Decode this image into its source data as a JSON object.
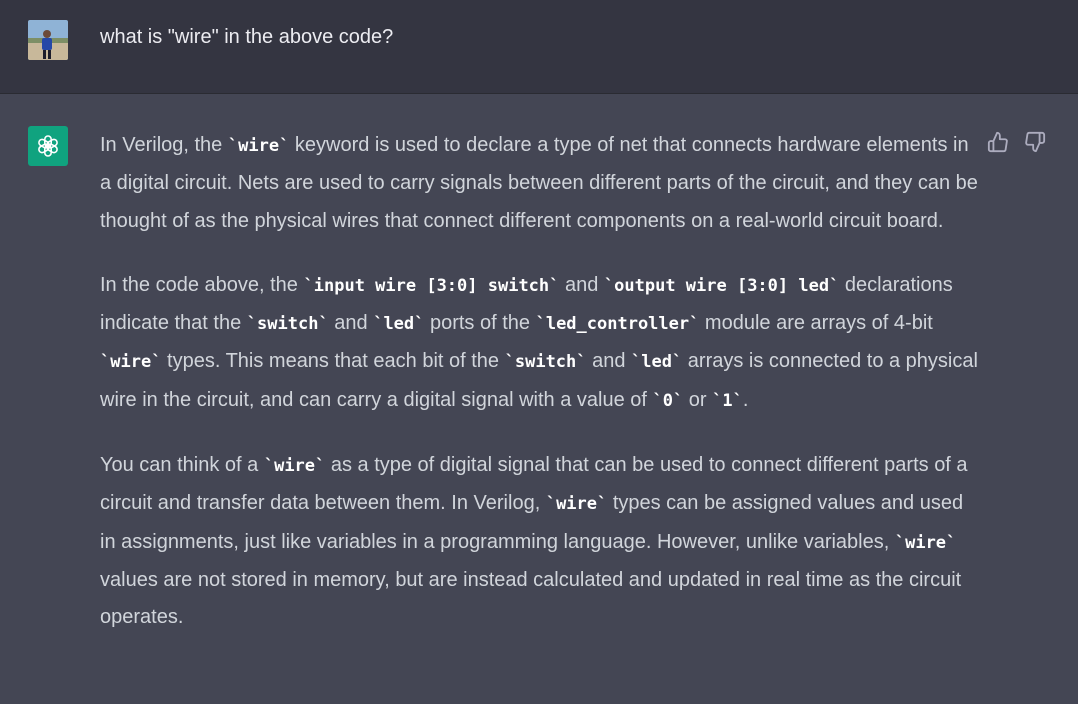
{
  "user_message": {
    "text": "what is \"wire\" in the above code?"
  },
  "assistant_message": {
    "paragraphs": [
      {
        "segments": [
          {
            "t": "text",
            "v": "In Verilog, the "
          },
          {
            "t": "code",
            "v": "wire"
          },
          {
            "t": "text",
            "v": " keyword is used to declare a type of net that connects hardware elements in a digital circuit. Nets are used to carry signals between different parts of the circuit, and they can be thought of as the physical wires that connect different components on a real-world circuit board."
          }
        ]
      },
      {
        "segments": [
          {
            "t": "text",
            "v": "In the code above, the "
          },
          {
            "t": "code",
            "v": "input wire [3:0] switch"
          },
          {
            "t": "text",
            "v": " and "
          },
          {
            "t": "code",
            "v": "output wire [3:0] led"
          },
          {
            "t": "text",
            "v": " declarations indicate that the "
          },
          {
            "t": "code",
            "v": "switch"
          },
          {
            "t": "text",
            "v": " and "
          },
          {
            "t": "code",
            "v": "led"
          },
          {
            "t": "text",
            "v": " ports of the "
          },
          {
            "t": "code",
            "v": "led_controller"
          },
          {
            "t": "text",
            "v": " module are arrays of 4-bit "
          },
          {
            "t": "code",
            "v": "wire"
          },
          {
            "t": "text",
            "v": " types. This means that each bit of the "
          },
          {
            "t": "code",
            "v": "switch"
          },
          {
            "t": "text",
            "v": " and "
          },
          {
            "t": "code",
            "v": "led"
          },
          {
            "t": "text",
            "v": " arrays is connected to a physical wire in the circuit, and can carry a digital signal with a value of "
          },
          {
            "t": "code",
            "v": "0"
          },
          {
            "t": "text",
            "v": " or "
          },
          {
            "t": "code",
            "v": "1"
          },
          {
            "t": "text",
            "v": "."
          }
        ]
      },
      {
        "segments": [
          {
            "t": "text",
            "v": "You can think of a "
          },
          {
            "t": "code",
            "v": "wire"
          },
          {
            "t": "text",
            "v": " as a type of digital signal that can be used to connect different parts of a circuit and transfer data between them. In Verilog, "
          },
          {
            "t": "code",
            "v": "wire"
          },
          {
            "t": "text",
            "v": " types can be assigned values and used in assignments, just like variables in a programming language. However, unlike variables, "
          },
          {
            "t": "code",
            "v": "wire"
          },
          {
            "t": "text",
            "v": " values are not stored in memory, but are instead calculated and updated in real time as the circuit operates."
          }
        ]
      }
    ]
  },
  "icons": {
    "user_avatar": "user-avatar-photo",
    "assistant_avatar": "openai-logo-icon",
    "thumbs_up": "thumbs-up-icon",
    "thumbs_down": "thumbs-down-icon"
  },
  "colors": {
    "user_row_bg": "#343541",
    "assistant_row_bg": "#444654",
    "assistant_avatar_bg": "#10a37f",
    "text": "#d1d5db"
  }
}
